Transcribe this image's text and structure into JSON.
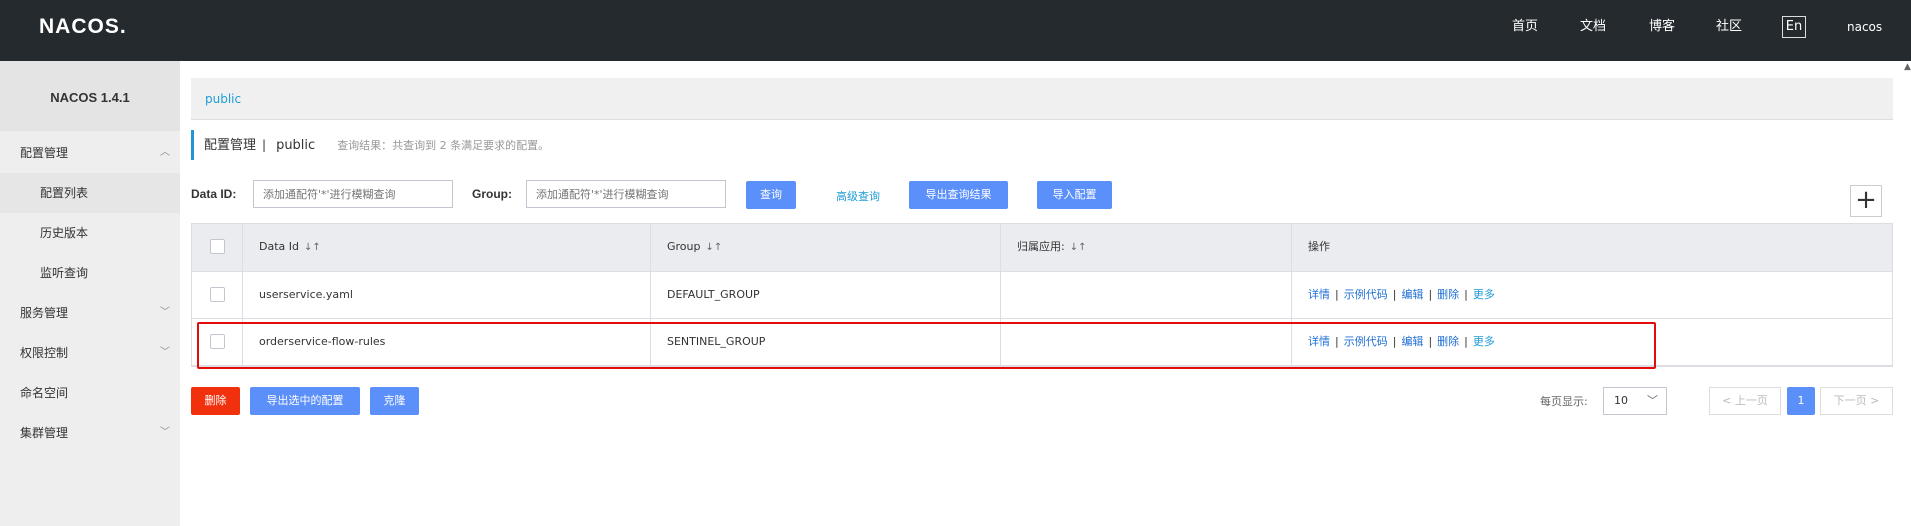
{
  "header": {
    "logo": "NACOS.",
    "nav": [
      "首页",
      "文档",
      "博客",
      "社区"
    ],
    "lang": "En",
    "user": "nacos"
  },
  "sidebar": {
    "version": "NACOS 1.4.1",
    "items": [
      {
        "label": "配置管理",
        "level": 1,
        "chevron": "up"
      },
      {
        "label": "配置列表",
        "level": 2,
        "active": true
      },
      {
        "label": "历史版本",
        "level": 2
      },
      {
        "label": "监听查询",
        "level": 2
      },
      {
        "label": "服务管理",
        "level": 1,
        "chevron": "down"
      },
      {
        "label": "权限控制",
        "level": 1,
        "chevron": "down"
      },
      {
        "label": "命名空间",
        "level": 1
      },
      {
        "label": "集群管理",
        "level": 1,
        "chevron": "down"
      }
    ]
  },
  "namespace_tab": "public",
  "title": {
    "main": "配置管理",
    "separator": "|",
    "namespace": "public",
    "hint": "查询结果：共查询到 2 条满足要求的配置。"
  },
  "search": {
    "dataid_label": "Data ID:",
    "dataid_placeholder": "添加通配符'*'进行模糊查询",
    "group_label": "Group:",
    "group_placeholder": "添加通配符'*'进行模糊查询",
    "query_btn": "查询",
    "advanced_link": "高级查询",
    "export_btn": "导出查询结果",
    "import_btn": "导入配置",
    "add_icon": "+"
  },
  "table": {
    "columns": [
      "Data Id",
      "Group",
      "归属应用:",
      "操作"
    ],
    "sort_icon": "↓↑",
    "rows": [
      {
        "data_id": "userservice.yaml",
        "group": "DEFAULT_GROUP",
        "app": ""
      },
      {
        "data_id": "orderservice-flow-rules",
        "group": "SENTINEL_GROUP",
        "app": ""
      }
    ],
    "actions": [
      "详情",
      "示例代码",
      "编辑",
      "删除",
      "更多"
    ]
  },
  "bulk": {
    "delete_btn": "删除",
    "export_selected_btn": "导出选中的配置",
    "clone_btn": "克隆"
  },
  "pagination": {
    "page_size_label": "每页显示:",
    "page_size": "10",
    "prev": "< 上一页",
    "current": "1",
    "next": "下一页 >"
  }
}
